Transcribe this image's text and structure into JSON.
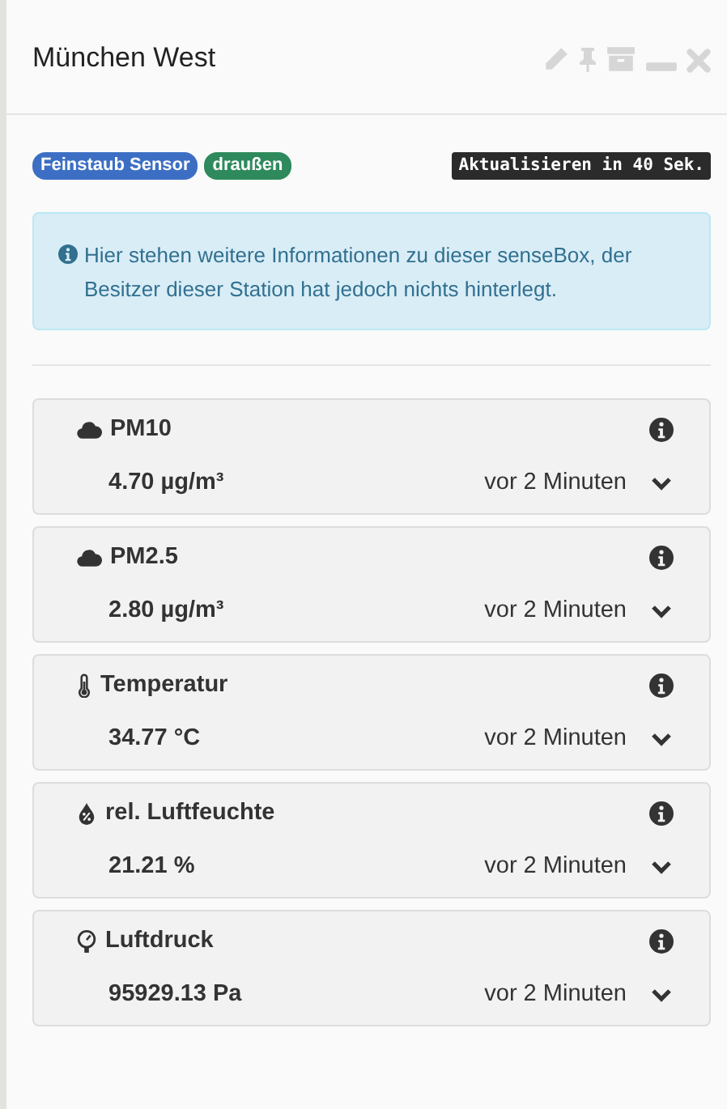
{
  "window": {
    "title": "München West"
  },
  "badges": [
    {
      "label": "Feinstaub Sensor",
      "color": "#3c6fc4"
    },
    {
      "label": "draußen",
      "color": "#2e8a5c"
    }
  ],
  "refresh": "Aktualisieren in 40 Sek.",
  "info": "Hier stehen weitere Informationen zu dieser senseBox, der Besitzer dieser Station hat jedoch nichts hinterlegt.",
  "sensors": [
    {
      "kind": "cloud",
      "name": "PM10",
      "value": "4.70 µg/m³",
      "time": "vor 2 Minuten",
      "expanded": false
    },
    {
      "kind": "cloud",
      "name": "PM2.5",
      "value": "2.80 µg/m³",
      "time": "vor 2 Minuten",
      "expanded": false
    },
    {
      "kind": "thermometer",
      "name": "Temperatur",
      "value": "34.77 °C",
      "time": "vor 2 Minuten",
      "expanded": false
    },
    {
      "kind": "drop",
      "name": "rel. Luftfeuchte",
      "value": "21.21 %",
      "time": "vor 2 Minuten",
      "expanded": false
    },
    {
      "kind": "gauge",
      "name": "Luftdruck",
      "value": "95929.13 Pa",
      "time": "vor 2 Minuten",
      "expanded": false
    }
  ]
}
